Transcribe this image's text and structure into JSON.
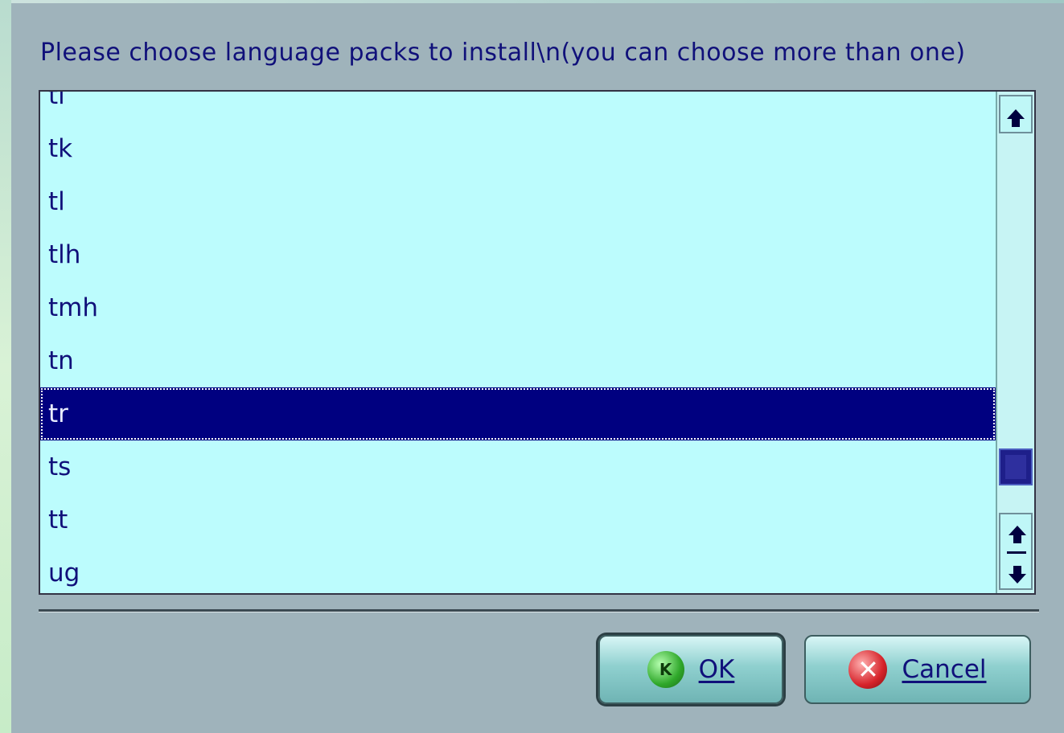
{
  "dialog": {
    "prompt": "Please choose language packs to install\\n(you can choose more than one)"
  },
  "list": {
    "items": [
      "ti",
      "tk",
      "tl",
      "tlh",
      "tmh",
      "tn",
      "tr",
      "ts",
      "tt",
      "ug"
    ],
    "selected": "tr"
  },
  "buttons": {
    "ok_label": "OK",
    "cancel_label": "Cancel"
  },
  "colors": {
    "background": "#9fb3bb",
    "list_background": "#bcfcfd",
    "selection": "#000080",
    "text": "#10107a"
  },
  "icons": {
    "ok": "kde-gear-icon",
    "cancel": "cancel-cross-icon",
    "scroll_up": "arrow-up-icon",
    "scroll_down": "arrow-down-icon"
  }
}
